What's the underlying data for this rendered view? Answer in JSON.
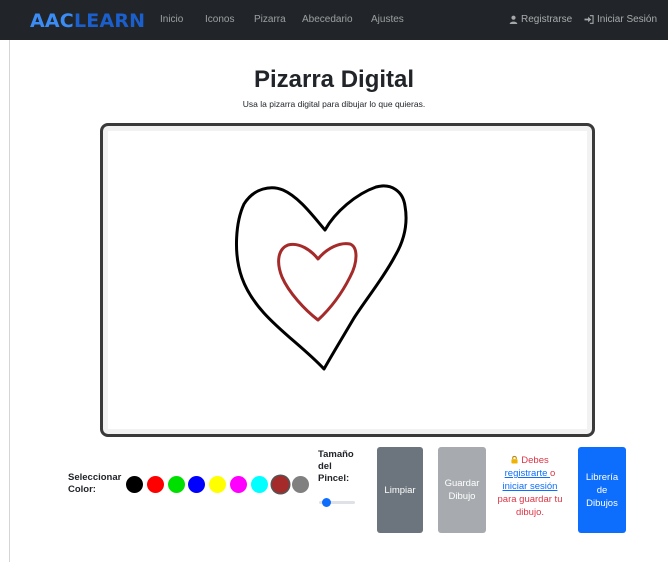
{
  "navbar": {
    "brand_part1": "AAC",
    "brand_part2": "LEARN",
    "links": [
      "Inicio",
      "Iconos",
      "Pizarra",
      "Abecedario",
      "Ajustes"
    ],
    "register": "Registrarse",
    "login": "Iniciar Sesión"
  },
  "header": {
    "title": "Pizarra Digital",
    "subtitle": "Usa la pizarra digital para dibujar lo que quieras."
  },
  "tools": {
    "color_label": "Seleccionar Color:",
    "colors": [
      "#000000",
      "#ff0000",
      "#00e000",
      "#0000ff",
      "#ffff00",
      "#ff00ff",
      "#00ffff",
      "#a52a2a",
      "#808080"
    ],
    "selected_color": "#a52a2a",
    "brush_label": "Tamaño del Pincel:",
    "brush_size_fraction": 0.1
  },
  "actions": {
    "clear": "Limpiar",
    "save": "Guardar Dibujo",
    "library": "Librería de Dibujos"
  },
  "notice": {
    "prefix": "Debes",
    "register_link": "registrarte ",
    "or": "o",
    "login_link": "iniciar sesión",
    "suffix": "para guardar tu dibujo."
  }
}
